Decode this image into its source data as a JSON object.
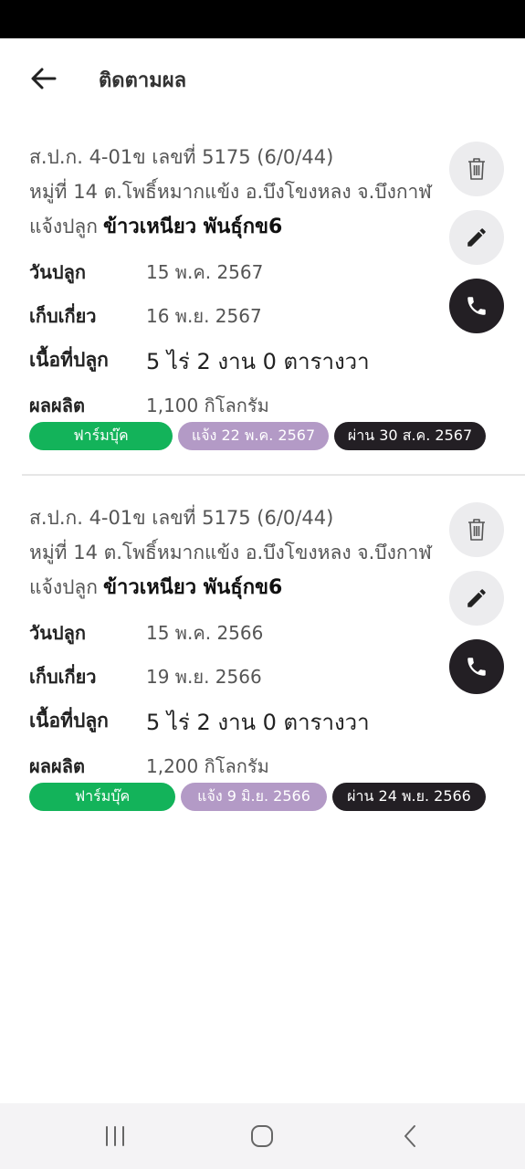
{
  "header": {
    "title": "ติดตามผล"
  },
  "records": [
    {
      "title": "ส.ป.ก. 4-01ข เลขที่ 5175 (6/0/44)",
      "address": "หมู่ที่ 14 ต.โพธิ์หมากแข้ง อ.บึงโขงหลง จ.บึงกาฬ",
      "plant_label": "แจ้งปลูก",
      "crop": "ข้าวเหนียว พันธุ์กข6",
      "plant_date_label": "วันปลูก",
      "plant_date": "15 พ.ค. 2567",
      "harvest_label": "เก็บเกี่ยว",
      "harvest_date": "16 พ.ย. 2567",
      "area_label": "เนื้อที่ปลูก",
      "area": "5 ไร่ 2 งาน 0 ตารางวา",
      "yield_label": "ผลผลิต",
      "yield": "1,100 กิโลกรัม",
      "badge_farm": "ฟาร์มบุ๊ค",
      "badge_notify": "แจ้ง 22 พ.ค. 2567",
      "badge_pass": "ผ่าน 30 ส.ค. 2567"
    },
    {
      "title": "ส.ป.ก. 4-01ข เลขที่ 5175 (6/0/44)",
      "address": "หมู่ที่ 14 ต.โพธิ์หมากแข้ง อ.บึงโขงหลง จ.บึงกาฬ",
      "plant_label": "แจ้งปลูก",
      "crop": "ข้าวเหนียว พันธุ์กข6",
      "plant_date_label": "วันปลูก",
      "plant_date": "15 พ.ค. 2566",
      "harvest_label": "เก็บเกี่ยว",
      "harvest_date": "19 พ.ย. 2566",
      "area_label": "เนื้อที่ปลูก",
      "area": "5 ไร่ 2 งาน 0 ตารางวา",
      "yield_label": "ผลผลิต",
      "yield": "1,200 กิโลกรัม",
      "badge_farm": "ฟาร์มบุ๊ค",
      "badge_notify": "แจ้ง 9 มิ.ย. 2566",
      "badge_pass": "ผ่าน 24 พ.ย. 2566"
    }
  ],
  "icons": {
    "back": "arrow-left-icon",
    "delete": "trash-icon",
    "edit": "pencil-icon",
    "call": "phone-icon",
    "nav_recent": "recent-apps-icon",
    "nav_home": "home-icon",
    "nav_back": "chevron-left-icon"
  },
  "colors": {
    "farm_badge": "#13b35a",
    "notify_badge": "#b39ac6",
    "pass_badge": "#231f24",
    "call_button": "#231f24"
  }
}
